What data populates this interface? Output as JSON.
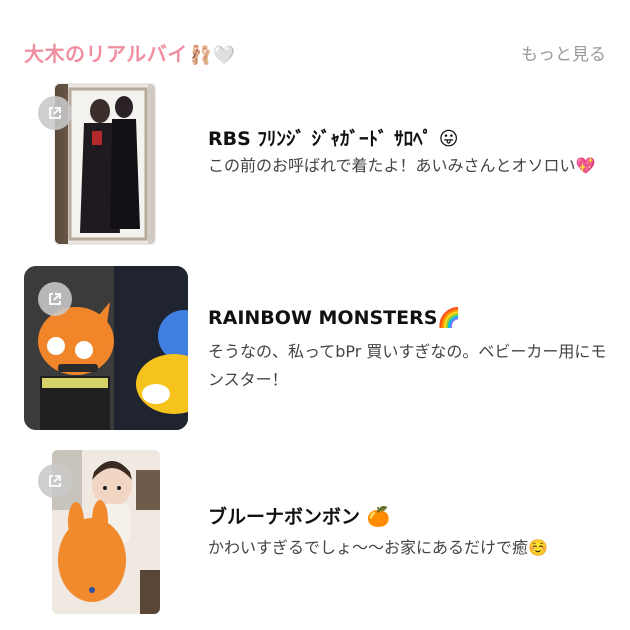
{
  "header": {
    "title": "大木のリアルバイ",
    "title_emoji": "🩰🤍",
    "more_label": "もっと見る",
    "accent_color": "#ef8fa0"
  },
  "items": [
    {
      "title": "RBS ﾌﾘﾝｼﾞ ｼﾞｬｶﾞｰﾄﾞ ｻﾛﾍﾟ",
      "title_emoji": "😛",
      "desc": "この前のお呼ばれで着たよ！あいみさんとオソロい",
      "desc_emoji": "💖",
      "thumb_icon": "open-external-icon"
    },
    {
      "title": "RAINBOW MONSTERS",
      "title_emoji": "🌈",
      "desc": "そうなの、私ってbPr 買いすぎなの。ベビーカー用にモンスター！",
      "desc_emoji": "",
      "thumb_icon": "open-external-icon"
    },
    {
      "title": "ブルーナボンボン",
      "title_emoji": "🍊",
      "desc": "かわいすぎるでしょ〜〜お家にあるだけで癒",
      "desc_emoji": "☺️",
      "thumb_icon": "open-external-icon"
    }
  ]
}
